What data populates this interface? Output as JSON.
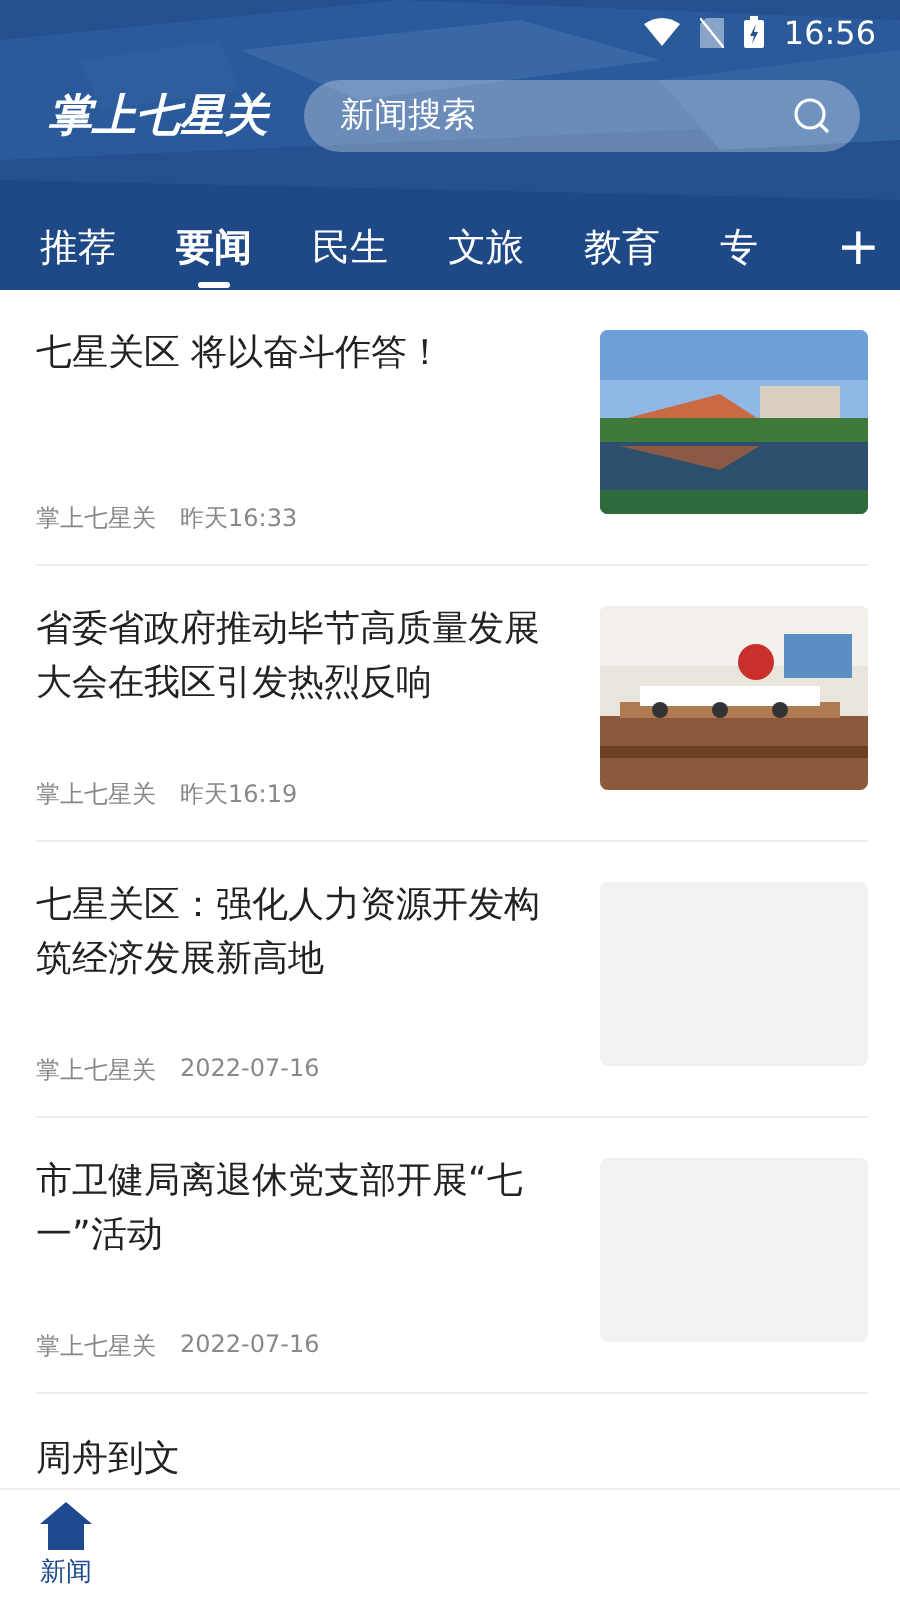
{
  "status_bar": {
    "time": "16:56"
  },
  "header": {
    "logo": "掌上七星关",
    "search": {
      "placeholder": "新闻搜索"
    }
  },
  "tabs": [
    {
      "label": "推荐",
      "selected": false
    },
    {
      "label": "要闻",
      "selected": true
    },
    {
      "label": "民生",
      "selected": false
    },
    {
      "label": "文旅",
      "selected": false
    },
    {
      "label": "教育",
      "selected": false
    },
    {
      "label": "专",
      "selected": false
    }
  ],
  "add_tab": "+",
  "articles": [
    {
      "title": "七星关区 将以奋斗作答！",
      "source": "掌上七星关",
      "time": "昨天16:33",
      "image": {
        "kind": "building"
      }
    },
    {
      "title": "省委省政府推动毕节高质量发展大会在我区引发热烈反响",
      "source": "掌上七星关",
      "time": "昨天16:19",
      "image": {
        "kind": "meeting"
      }
    },
    {
      "title": "七星关区：强化人力资源开发构筑经济发展新高地",
      "source": "掌上七星关",
      "time": "2022-07-16",
      "image": {
        "kind": "placeholder"
      }
    },
    {
      "title": "市卫健局离退休党支部开展“七一”活动",
      "source": "掌上七星关",
      "time": "2022-07-16",
      "image": {
        "kind": "placeholder"
      }
    }
  ],
  "partial_article": {
    "title": "周舟到文"
  },
  "bottom_nav": [
    {
      "label": "新闻",
      "selected": true
    }
  ]
}
